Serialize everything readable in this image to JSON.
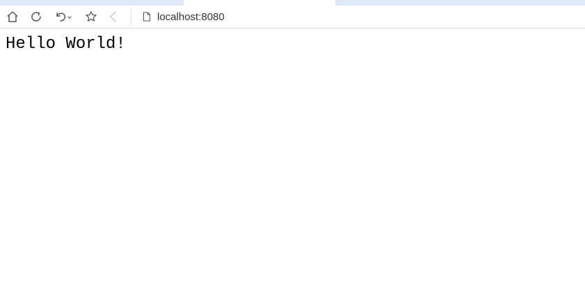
{
  "toolbar": {
    "icons": {
      "home": "home-icon",
      "reload": "reload-icon",
      "undo": "undo-icon",
      "favorite": "star-icon",
      "back": "back-arrow-icon",
      "page": "page-icon"
    },
    "address": {
      "url": "localhost:8080"
    }
  },
  "page": {
    "text": "Hello World!"
  },
  "colors": {
    "tab_inactive": "#dee9f8",
    "toolbar_border": "#d6d6d6",
    "icon": "#555555",
    "icon_disabled": "#c8c8c8"
  }
}
